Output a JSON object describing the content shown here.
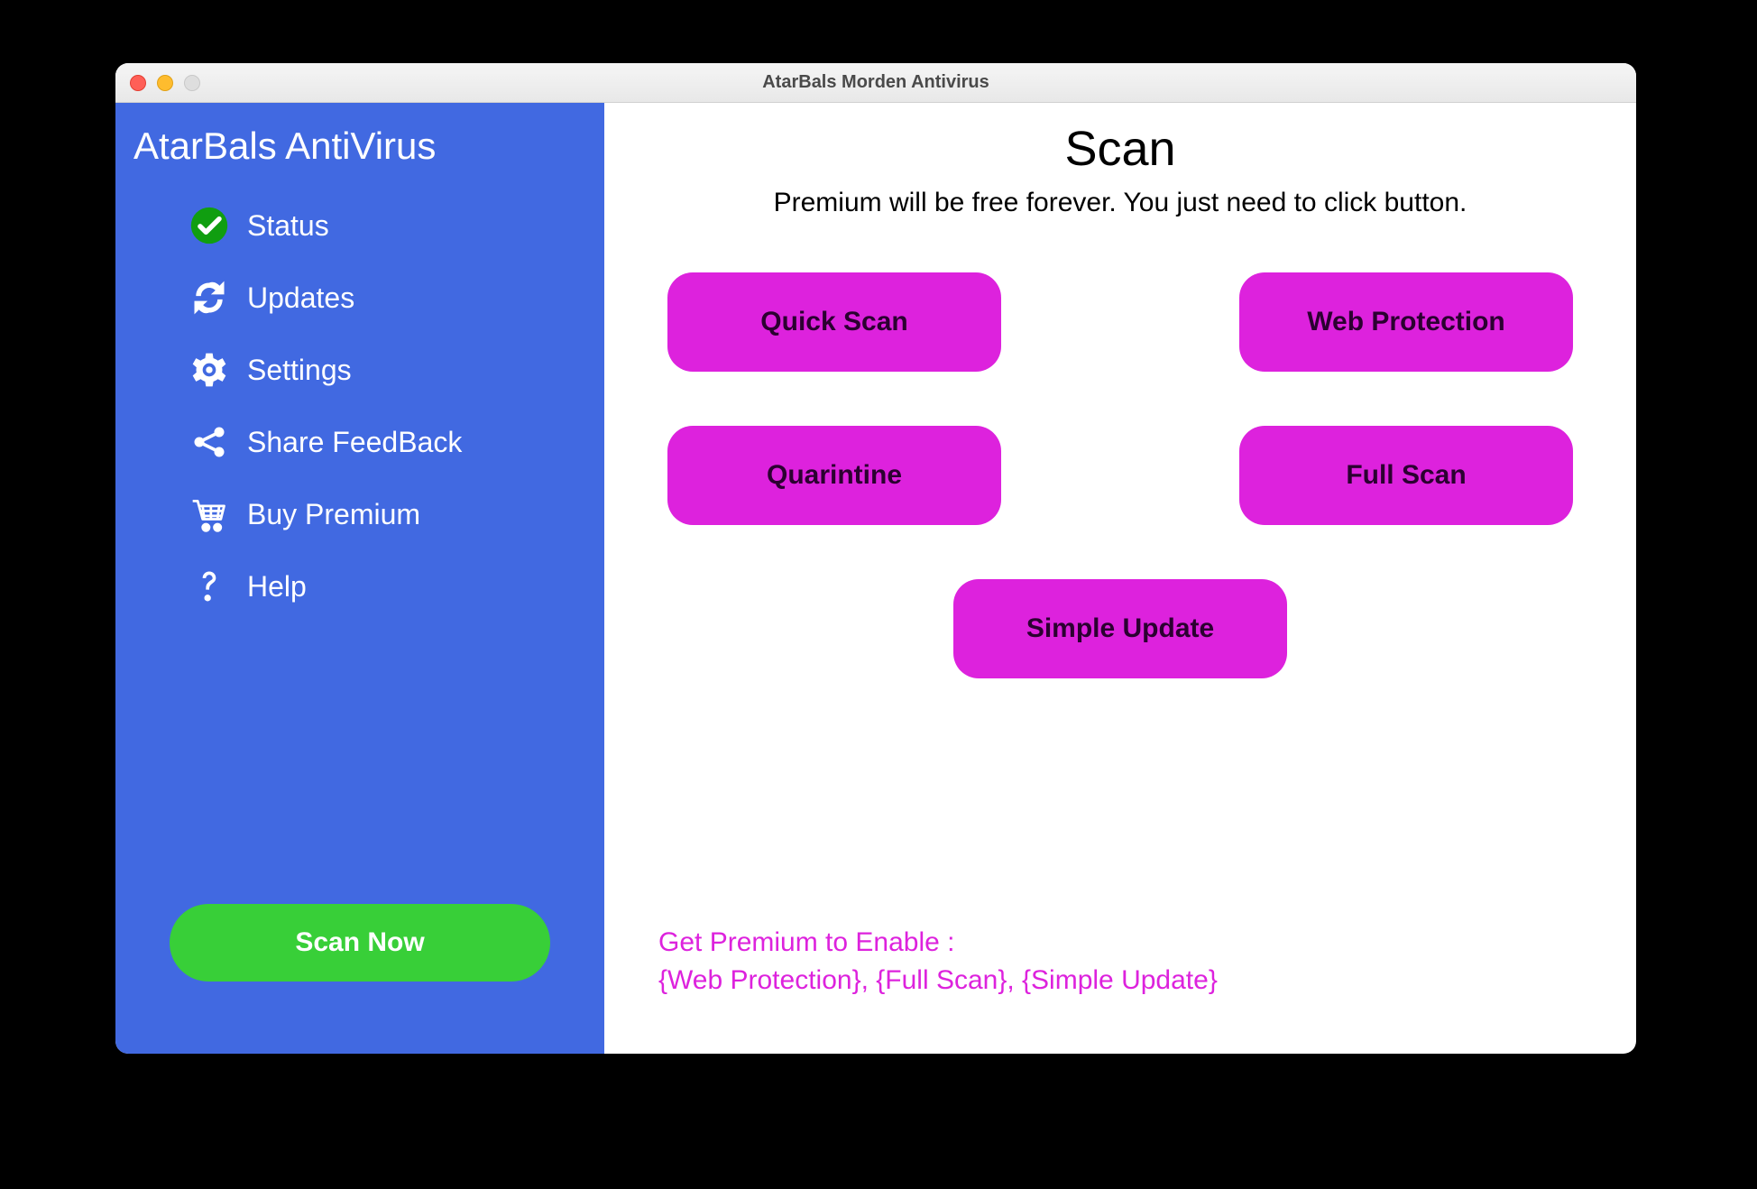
{
  "titlebar": {
    "title": "AtarBals Morden Antivirus"
  },
  "sidebar": {
    "app_title": "AtarBals AntiVirus",
    "items": [
      {
        "label": "Status",
        "icon": "check-circle-icon"
      },
      {
        "label": "Updates",
        "icon": "refresh-icon"
      },
      {
        "label": "Settings",
        "icon": "gear-icon"
      },
      {
        "label": "Share FeedBack",
        "icon": "share-icon"
      },
      {
        "label": "Buy Premium",
        "icon": "cart-icon"
      },
      {
        "label": "Help",
        "icon": "question-icon"
      }
    ],
    "scan_now_label": "Scan Now"
  },
  "main": {
    "title": "Scan",
    "subtitle": "Premium will be free forever. You just need to click button.",
    "buttons": {
      "quick_scan": "Quick Scan",
      "web_protection": "Web Protection",
      "quarantine": "Quarintine",
      "full_scan": "Full Scan",
      "simple_update": "Simple Update"
    },
    "premium_line1": "Get Premium to Enable :",
    "premium_line2": "{Web Protection}, {Full Scan}, {Simple Update}"
  },
  "colors": {
    "sidebar_bg": "#4169e1",
    "action_button": "#dd22dd",
    "scan_now": "#38cf38",
    "status_check": "#109e10"
  }
}
